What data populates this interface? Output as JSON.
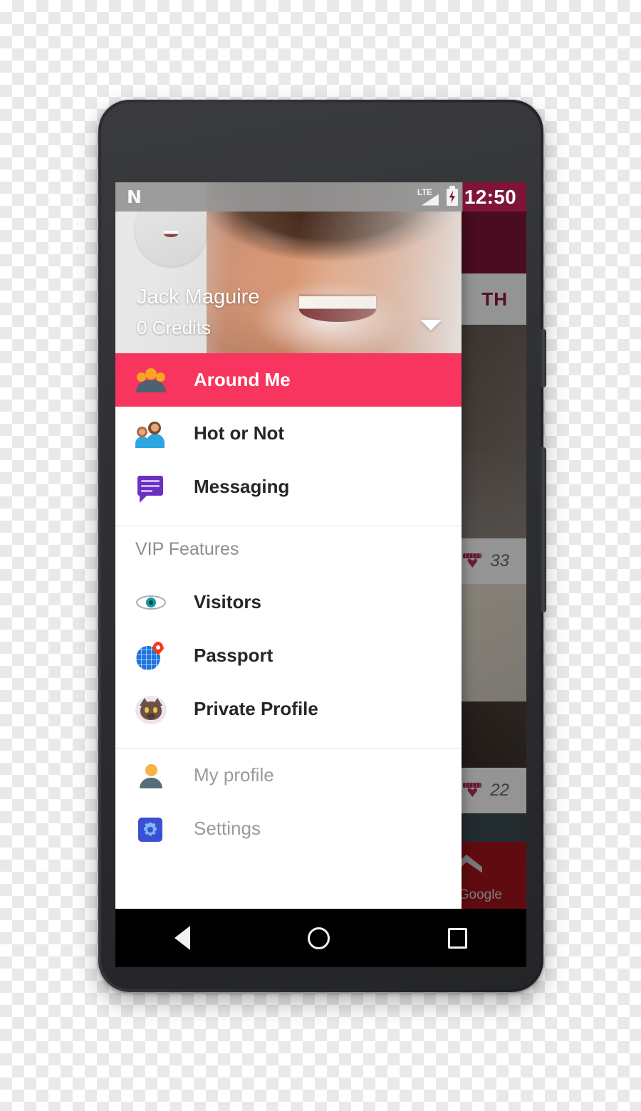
{
  "status_bar": {
    "os_logo": "android-n-logo",
    "network_label": "LTE",
    "signal_icon": "signal-bars-icon",
    "battery_icon": "battery-charging-icon",
    "clock": "12:50"
  },
  "drawer": {
    "user_name": "Jack Maguire",
    "credits": "0 Credits",
    "account_switcher_icon": "chevron-down-icon",
    "avatar_icon": "avatar",
    "primary_items": [
      {
        "label": "Around Me",
        "icon": "people-group-icon",
        "selected": true
      },
      {
        "label": "Hot or Not",
        "icon": "couple-icon",
        "selected": false
      },
      {
        "label": "Messaging",
        "icon": "chat-bubble-icon",
        "selected": false
      }
    ],
    "vip_section_label": "VIP Features",
    "vip_items": [
      {
        "label": "Visitors",
        "icon": "eye-icon"
      },
      {
        "label": "Passport",
        "icon": "globe-pin-icon"
      },
      {
        "label": "Private Profile",
        "icon": "cat-icon"
      }
    ],
    "footer_items": [
      {
        "label": "My profile",
        "icon": "person-icon"
      },
      {
        "label": "Settings",
        "icon": "gear-icon"
      }
    ],
    "selected_color": "#f8355e"
  },
  "background_app": {
    "appbar_color": "#7e1538",
    "tab_label": "TH",
    "cards": [
      {
        "count": "33",
        "badge_icon": "crown-heart-icon"
      },
      {
        "count": "22",
        "badge_icon": "crown-heart-icon"
      }
    ],
    "ad_attribution": "y Google"
  },
  "nav_bar": {
    "back_icon": "back-triangle-icon",
    "home_icon": "home-circle-icon",
    "recents_icon": "recents-square-icon"
  },
  "device": {
    "front_camera_icon": "front-camera-icon",
    "earpiece_icon": "earpiece-speaker-icon",
    "bottom_speaker_icon": "bottom-speaker-icon",
    "power_button_icon": "power-button",
    "volume_button_icon": "volume-button"
  }
}
